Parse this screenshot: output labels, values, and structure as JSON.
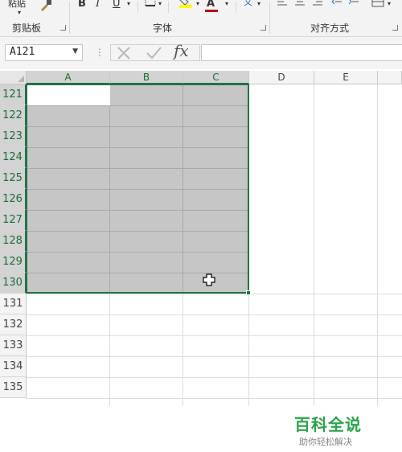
{
  "ribbon": {
    "clipboard_label": "剪贴板",
    "font_label": "字体",
    "alignment_label": "对齐方式",
    "paste_label": "粘贴",
    "bold_label": "B",
    "italic_label": "I",
    "underline_label": "U",
    "font_color_letter": "A",
    "font_color": "#c00000",
    "highlight_color": "#ffff00"
  },
  "formula_bar": {
    "name_box_value": "A121",
    "fx_label": "fx",
    "formula_value": ""
  },
  "grid": {
    "columns": [
      "A",
      "B",
      "C",
      "D",
      "E"
    ],
    "rows": [
      "121",
      "122",
      "123",
      "124",
      "125",
      "126",
      "127",
      "128",
      "129",
      "130",
      "131",
      "132",
      "133",
      "134",
      "135"
    ],
    "selected_range": "A121:C130",
    "accent_color": "#217346"
  },
  "watermark": {
    "title": "百科全说",
    "subtitle": "助你轻松解决"
  }
}
